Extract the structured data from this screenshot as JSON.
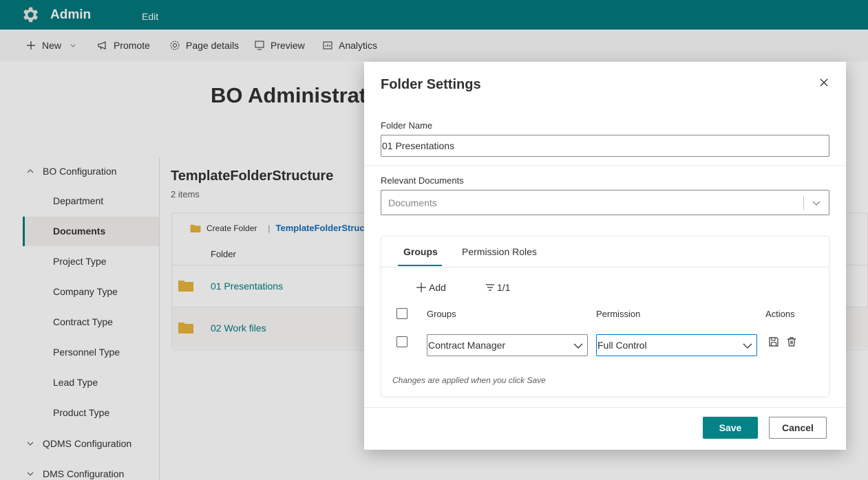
{
  "app": {
    "title": "Admin",
    "edit_label": "Edit"
  },
  "commandbar": {
    "new": "New",
    "promote": "Promote",
    "page_details": "Page details",
    "preview": "Preview",
    "analytics": "Analytics"
  },
  "page": {
    "title": "BO Administrat"
  },
  "leftnav": {
    "group1": "BO Configuration",
    "items": [
      {
        "label": "Department"
      },
      {
        "label": "Documents"
      },
      {
        "label": "Project Type"
      },
      {
        "label": "Company Type"
      },
      {
        "label": "Contract Type"
      },
      {
        "label": "Personnel Type"
      },
      {
        "label": "Lead Type"
      },
      {
        "label": "Product Type"
      }
    ],
    "group2": "QDMS Configuration",
    "group3": "DMS Configuration"
  },
  "content": {
    "title": "TemplateFolderStructure",
    "count": "2 items",
    "create_folder": "Create Folder",
    "breadcrumb": "TemplateFolderStructure",
    "column_folder": "Folder",
    "rows": [
      {
        "name": "01 Presentations"
      },
      {
        "name": "02 Work files"
      }
    ]
  },
  "dialog": {
    "title": "Folder Settings",
    "folder_name_label": "Folder Name",
    "folder_name_value": "01 Presentations",
    "relevant_documents_label": "Relevant Documents",
    "documents_placeholder": "Documents",
    "tabs": [
      {
        "label": "Groups",
        "active": true
      },
      {
        "label": "Permission Roles",
        "active": false
      }
    ],
    "add_label": "Add",
    "filter_label": "1/1",
    "columns": {
      "groups": "Groups",
      "permission": "Permission",
      "actions": "Actions"
    },
    "row": {
      "group": "Contract Manager",
      "permission": "Full Control"
    },
    "hint": "Changes are applied when you click Save",
    "save": "Save",
    "cancel": "Cancel"
  },
  "colors": {
    "brand": "#03787c",
    "primary_button": "#038387"
  }
}
